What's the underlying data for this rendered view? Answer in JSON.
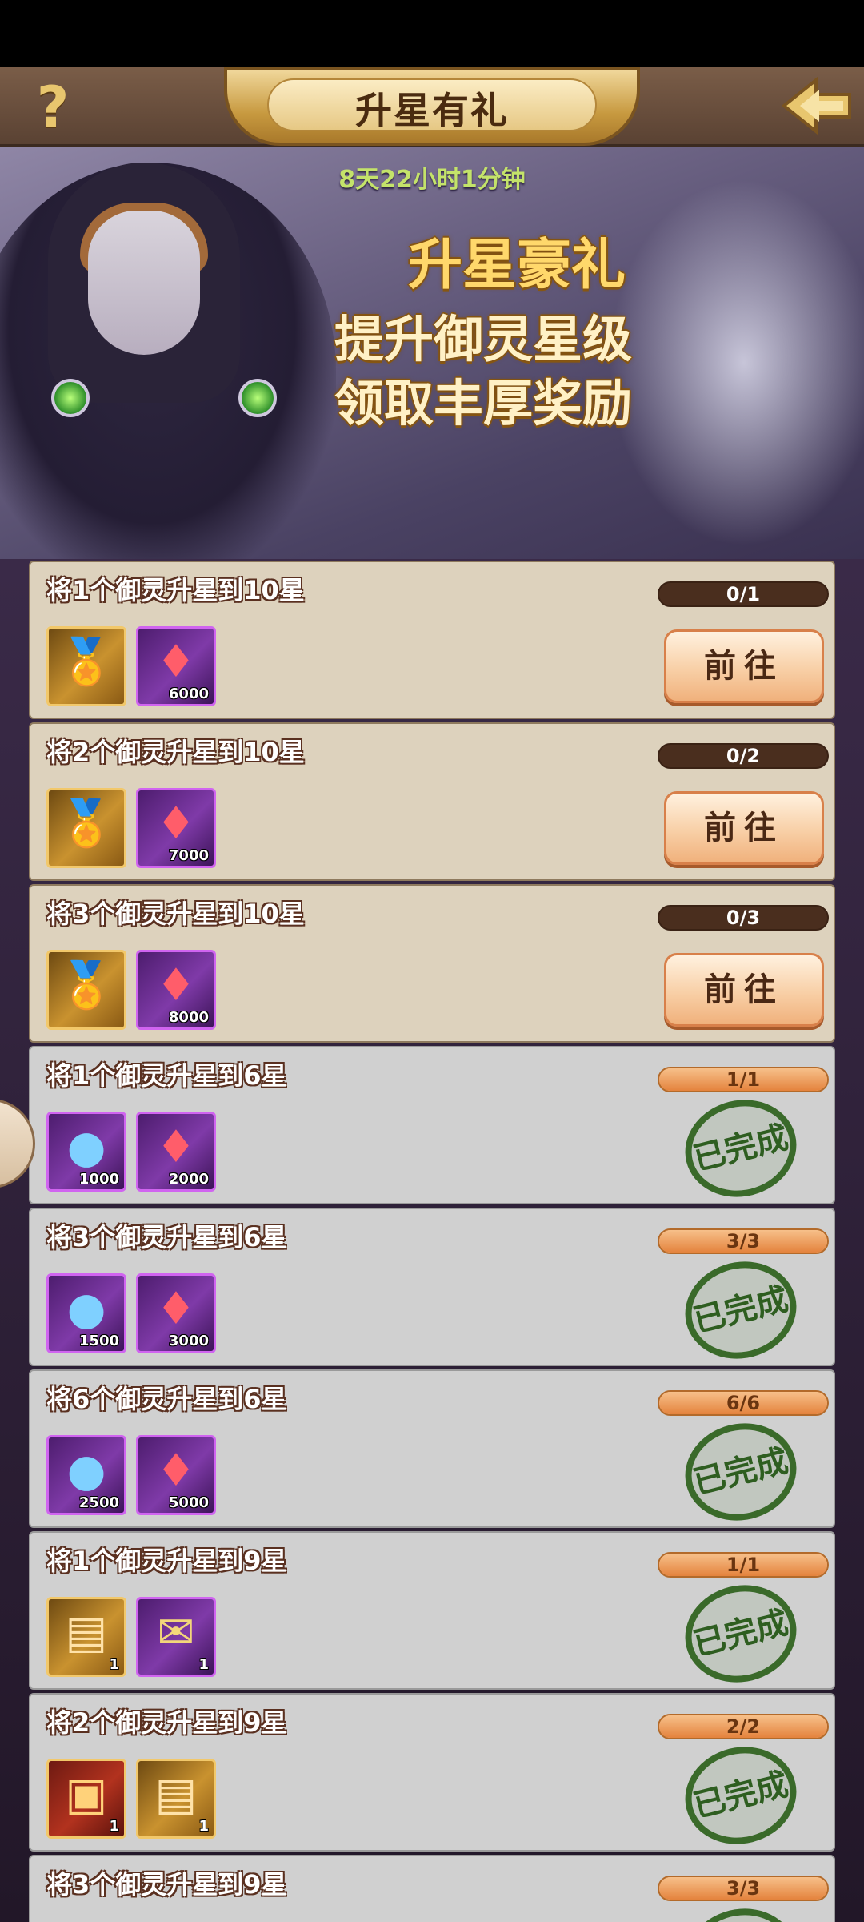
{
  "header": {
    "title": "升星有礼",
    "help_label": "?"
  },
  "banner": {
    "timer": "8天22小时1分钟",
    "promo_title": "升星豪礼",
    "promo_line1": "提升御灵星级",
    "promo_line2": "领取丰厚奖励"
  },
  "tasks": [
    {
      "title": "将1个御灵升星到10星",
      "progress": "0/1",
      "fraction": 0,
      "status": "go",
      "rewards": [
        {
          "icon": "gold-medal-icon",
          "qty": ""
        },
        {
          "icon": "red-gem-icon",
          "qty": "6000"
        }
      ]
    },
    {
      "title": "将2个御灵升星到10星",
      "progress": "0/2",
      "fraction": 0,
      "status": "go",
      "rewards": [
        {
          "icon": "gold-medal-icon",
          "qty": ""
        },
        {
          "icon": "red-gem-icon",
          "qty": "7000"
        }
      ]
    },
    {
      "title": "将3个御灵升星到10星",
      "progress": "0/3",
      "fraction": 0,
      "status": "go",
      "rewards": [
        {
          "icon": "gold-medal-icon",
          "qty": ""
        },
        {
          "icon": "red-gem-icon",
          "qty": "8000"
        }
      ]
    },
    {
      "title": "将1个御灵升星到6星",
      "progress": "1/1",
      "fraction": 1,
      "status": "done",
      "rewards": [
        {
          "icon": "blue-orb-icon",
          "qty": "1000"
        },
        {
          "icon": "red-gem-icon",
          "qty": "2000"
        }
      ]
    },
    {
      "title": "将3个御灵升星到6星",
      "progress": "3/3",
      "fraction": 1,
      "status": "done",
      "rewards": [
        {
          "icon": "blue-orb-icon",
          "qty": "1500"
        },
        {
          "icon": "red-gem-icon",
          "qty": "3000"
        }
      ]
    },
    {
      "title": "将6个御灵升星到6星",
      "progress": "6/6",
      "fraction": 1,
      "status": "done",
      "rewards": [
        {
          "icon": "blue-orb-icon",
          "qty": "2500"
        },
        {
          "icon": "red-gem-icon",
          "qty": "5000"
        }
      ]
    },
    {
      "title": "将1个御灵升星到9星",
      "progress": "1/1",
      "fraction": 1,
      "status": "done",
      "rewards": [
        {
          "icon": "ticket-icon",
          "qty": "1"
        },
        {
          "icon": "scroll-icon",
          "qty": "1"
        }
      ]
    },
    {
      "title": "将2个御灵升星到9星",
      "progress": "2/2",
      "fraction": 1,
      "status": "done",
      "rewards": [
        {
          "icon": "treasure-chest-icon",
          "qty": "1"
        },
        {
          "icon": "ticket-icon",
          "qty": "1"
        }
      ]
    },
    {
      "title": "将3个御灵升星到9星",
      "progress": "3/3",
      "fraction": 1,
      "status": "done",
      "rewards": []
    }
  ],
  "labels": {
    "go": "前往",
    "done": "已完成"
  },
  "colors": {
    "accent_orange": "#e4833d",
    "stamp_green": "#2e5e20",
    "timer_green": "#c4e36a"
  }
}
